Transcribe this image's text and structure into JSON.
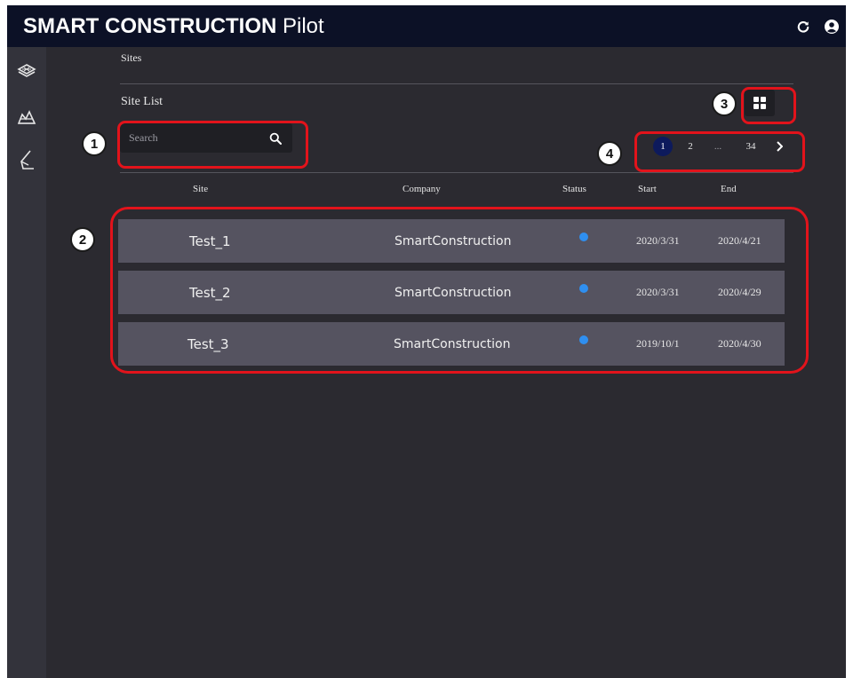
{
  "app": {
    "title_bold": "SMART CONSTRUCTION",
    "title_rest": "Pilot"
  },
  "topbar": {
    "refresh_icon": "refresh-icon",
    "account_icon": "user-circle-icon"
  },
  "sidebar": {
    "items": [
      {
        "name": "layers",
        "icon": "layers-icon"
      },
      {
        "name": "terrain",
        "icon": "terrain-icon"
      },
      {
        "name": "slope",
        "icon": "slope-icon"
      }
    ]
  },
  "breadcrumb": {
    "label": "Sites"
  },
  "site_list": {
    "title": "Site List",
    "search": {
      "placeholder": "Search",
      "value": ""
    },
    "view_toggle": {
      "icon": "grid-view-icon"
    },
    "pagination": {
      "pages": [
        "1",
        "2",
        "...",
        "34"
      ],
      "current": "1",
      "next_icon": "chevron-right-icon"
    },
    "columns": {
      "site": "Site",
      "company": "Company",
      "status": "Status",
      "start": "Start",
      "end": "End"
    },
    "rows": [
      {
        "site": "Test_1",
        "company": "SmartConstruction",
        "status_color": "#2f8ff0",
        "start": "2020/3/31",
        "end": "2020/4/21"
      },
      {
        "site": "Test_2",
        "company": "SmartConstruction",
        "status_color": "#2f8ff0",
        "start": "2020/3/31",
        "end": "2020/4/29"
      },
      {
        "site": "Test_3",
        "company": "SmartConstruction",
        "status_color": "#2f8ff0",
        "start": "2019/10/1",
        "end": "2020/4/30"
      }
    ]
  },
  "annotations": [
    "1",
    "2",
    "3",
    "4"
  ],
  "colors": {
    "topbar": "#0c1126",
    "background": "#2b2a30",
    "row": "#555360",
    "callout": "#e2131b",
    "page_active": "#0d1a5c"
  }
}
